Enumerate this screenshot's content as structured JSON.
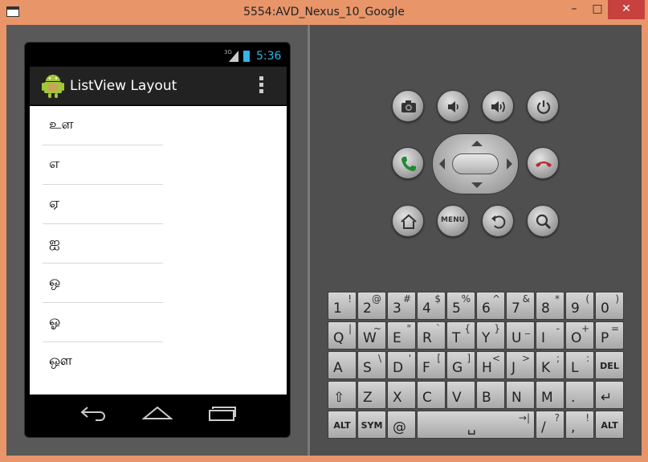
{
  "window": {
    "title": "5554:AVD_Nexus_10_Google",
    "min_label": "–",
    "max_label": "□",
    "close_label": "✕"
  },
  "statusbar": {
    "network": "3G",
    "time": "5:36"
  },
  "app": {
    "title": "ListView Layout"
  },
  "list": {
    "items": [
      {
        "label": "உள"
      },
      {
        "label": "எ"
      },
      {
        "label": "ஏ"
      },
      {
        "label": "ஐ"
      },
      {
        "label": "ஒ"
      },
      {
        "label": "ஓ"
      },
      {
        "label": "ஔ"
      }
    ]
  },
  "hw_buttons": {
    "menu_label": "MENU"
  },
  "keyboard": {
    "row1": [
      {
        "main": "1",
        "alt": "!"
      },
      {
        "main": "2",
        "alt": "@"
      },
      {
        "main": "3",
        "alt": "#"
      },
      {
        "main": "4",
        "alt": "$"
      },
      {
        "main": "5",
        "alt": "%"
      },
      {
        "main": "6",
        "alt": "^"
      },
      {
        "main": "7",
        "alt": "&"
      },
      {
        "main": "8",
        "alt": "*"
      },
      {
        "main": "9",
        "alt": "("
      },
      {
        "main": "0",
        "alt": ")"
      }
    ],
    "row2": [
      {
        "main": "Q",
        "alt": "|"
      },
      {
        "main": "W",
        "alt": "~"
      },
      {
        "main": "E",
        "alt": "\""
      },
      {
        "main": "R",
        "alt": "`"
      },
      {
        "main": "T",
        "alt": "{"
      },
      {
        "main": "Y",
        "alt": "}"
      },
      {
        "main": "U",
        "alt": "_"
      },
      {
        "main": "I",
        "alt": "-"
      },
      {
        "main": "O",
        "alt": "+"
      },
      {
        "main": "P",
        "alt": "="
      }
    ],
    "row3": [
      {
        "main": "A",
        "alt": ""
      },
      {
        "main": "S",
        "alt": "\\"
      },
      {
        "main": "D",
        "alt": "'"
      },
      {
        "main": "F",
        "alt": "["
      },
      {
        "main": "G",
        "alt": "]"
      },
      {
        "main": "H",
        "alt": "<"
      },
      {
        "main": "J",
        "alt": ">"
      },
      {
        "main": "K",
        "alt": ";"
      },
      {
        "main": "L",
        "alt": ":"
      },
      {
        "main": "DEL",
        "alt": ""
      }
    ],
    "row4": [
      {
        "main": "⇧",
        "alt": ""
      },
      {
        "main": "Z",
        "alt": ""
      },
      {
        "main": "X",
        "alt": ""
      },
      {
        "main": "C",
        "alt": ""
      },
      {
        "main": "V",
        "alt": ""
      },
      {
        "main": "B",
        "alt": ""
      },
      {
        "main": "N",
        "alt": ""
      },
      {
        "main": "M",
        "alt": ""
      },
      {
        "main": ".",
        "alt": ""
      },
      {
        "main": "↵",
        "alt": ""
      }
    ],
    "row5": [
      {
        "main": "ALT",
        "alt": ""
      },
      {
        "main": "SYM",
        "alt": ""
      },
      {
        "main": "@",
        "alt": ""
      },
      {
        "main": "␣",
        "alt": "→|"
      },
      {
        "main": "/",
        "alt": "?"
      },
      {
        "main": ",",
        "alt": "!"
      },
      {
        "main": "ALT",
        "alt": ""
      }
    ]
  },
  "colors": {
    "accent": "#33b5e5",
    "call_green": "#1f8a2e",
    "end_red": "#c0262b",
    "frame": "#e8956a"
  }
}
